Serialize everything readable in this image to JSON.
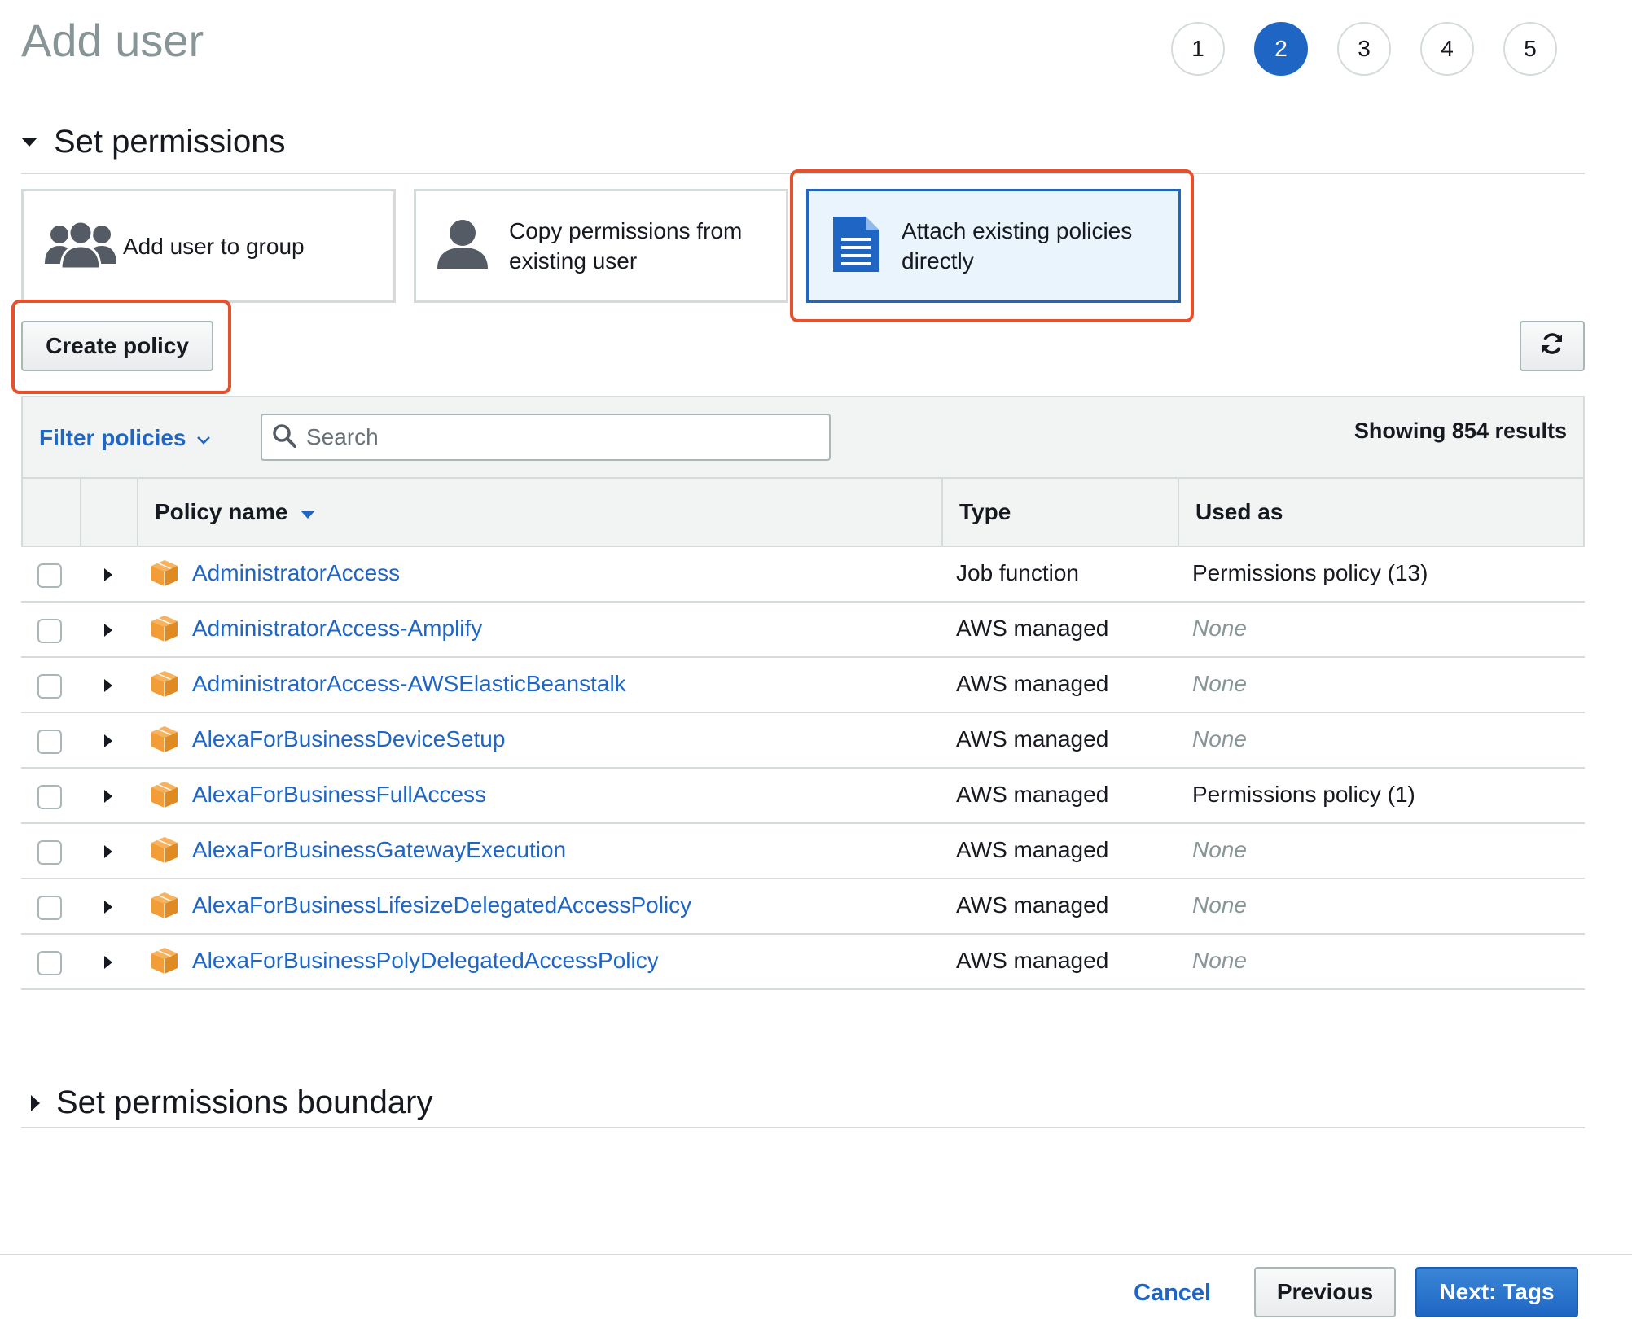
{
  "page": {
    "title": "Add user"
  },
  "steps": [
    "1",
    "2",
    "3",
    "4",
    "5"
  ],
  "active_step": "2",
  "section_permissions": {
    "title": "Set permissions"
  },
  "options": [
    {
      "label": "Add user to group",
      "icon": "group-icon",
      "selected": false
    },
    {
      "label": "Copy permissions from existing user",
      "icon": "user-icon",
      "selected": false
    },
    {
      "label": "Attach existing policies directly",
      "icon": "document-icon",
      "selected": true
    }
  ],
  "actions": {
    "create_policy": "Create policy",
    "refresh_icon": "refresh-icon"
  },
  "filter": {
    "label": "Filter policies",
    "search_placeholder": "Search",
    "results": "Showing 854 results"
  },
  "table": {
    "columns": {
      "name": "Policy name",
      "type": "Type",
      "used": "Used as"
    },
    "rows": [
      {
        "name": "AdministratorAccess",
        "type": "Job function",
        "used": "Permissions policy (13)"
      },
      {
        "name": "AdministratorAccess-Amplify",
        "type": "AWS managed",
        "used": "None"
      },
      {
        "name": "AdministratorAccess-AWSElasticBeanstalk",
        "type": "AWS managed",
        "used": "None"
      },
      {
        "name": "AlexaForBusinessDeviceSetup",
        "type": "AWS managed",
        "used": "None"
      },
      {
        "name": "AlexaForBusinessFullAccess",
        "type": "AWS managed",
        "used": "Permissions policy (1)"
      },
      {
        "name": "AlexaForBusinessGatewayExecution",
        "type": "AWS managed",
        "used": "None"
      },
      {
        "name": "AlexaForBusinessLifesizeDelegatedAccessPolicy",
        "type": "AWS managed",
        "used": "None"
      },
      {
        "name": "AlexaForBusinessPolyDelegatedAccessPolicy",
        "type": "AWS managed",
        "used": "None"
      }
    ]
  },
  "section_boundary": {
    "title": "Set permissions boundary"
  },
  "footer": {
    "cancel": "Cancel",
    "previous": "Previous",
    "next": "Next: Tags"
  },
  "colors": {
    "accent": "#1f66c4",
    "highlight": "#e6512b",
    "package": "#f29d38"
  }
}
